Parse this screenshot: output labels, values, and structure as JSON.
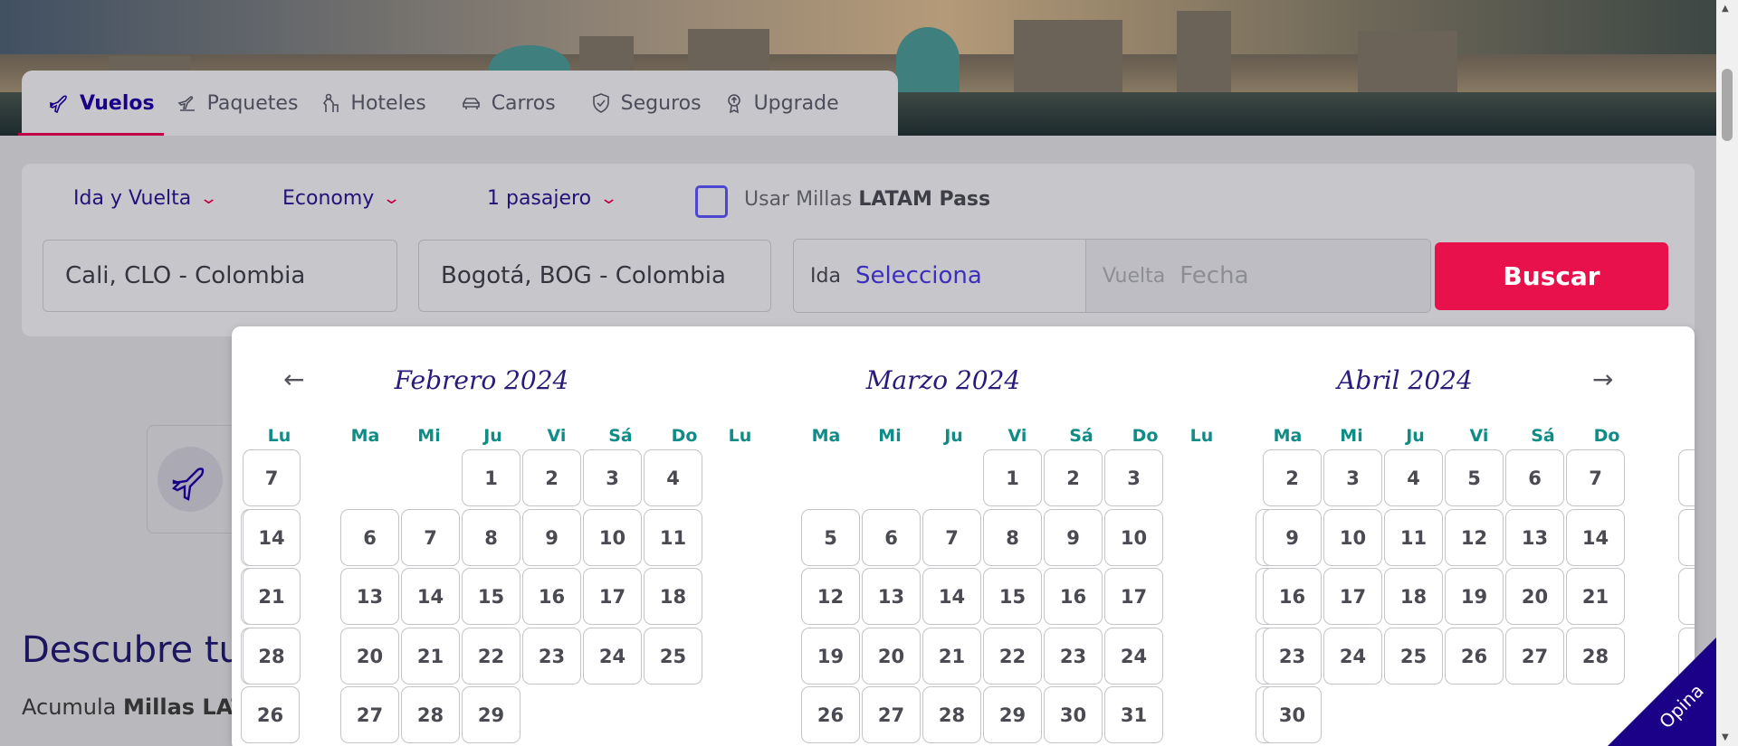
{
  "tabs": [
    {
      "label": "Vuelos",
      "icon": "plane-icon",
      "active": true
    },
    {
      "label": "Paquetes",
      "icon": "package-plane-icon"
    },
    {
      "label": "Hoteles",
      "icon": "hotel-person-icon"
    },
    {
      "label": "Carros",
      "icon": "car-icon"
    },
    {
      "label": "Seguros",
      "icon": "shield-icon"
    },
    {
      "label": "Upgrade",
      "icon": "upgrade-badge-icon"
    }
  ],
  "search": {
    "trip_type": "Ida y Vuelta",
    "cabin": "Economy",
    "passengers": "1 pasajero",
    "miles_prefix": "Usar Millas ",
    "miles_brand": "LATAM Pass",
    "origin": "Cali, CLO - Colombia",
    "destination": "Bogotá, BOG - Colombia",
    "ida_label": "Ida",
    "ida_value": "Selecciona",
    "vuelta_label": "Vuelta",
    "vuelta_value": "Fecha",
    "button": "Buscar"
  },
  "background": {
    "heading": "Descubre tu",
    "sub_prefix": "Acumula ",
    "sub_bold": "Millas LATA"
  },
  "calendar": {
    "weekdays": [
      "Lu",
      "Ma",
      "Mi",
      "Ju",
      "Vi",
      "Sá",
      "Do"
    ],
    "months": [
      {
        "title": "Febrero 2024",
        "first_col": 3,
        "days": 29,
        "clipped_col": 0,
        "clipped_days": [
          "7",
          "14",
          "21",
          "28"
        ]
      },
      {
        "title": "Marzo 2024",
        "first_col": 4,
        "days": 31
      },
      {
        "title": "Abril 2024",
        "first_col": 0,
        "days": 30
      }
    ]
  },
  "feedback": {
    "label": "Opina"
  },
  "colors": {
    "brand_navy": "#1b0088",
    "brand_red": "#e8114c",
    "weekday_teal": "#108c87"
  }
}
